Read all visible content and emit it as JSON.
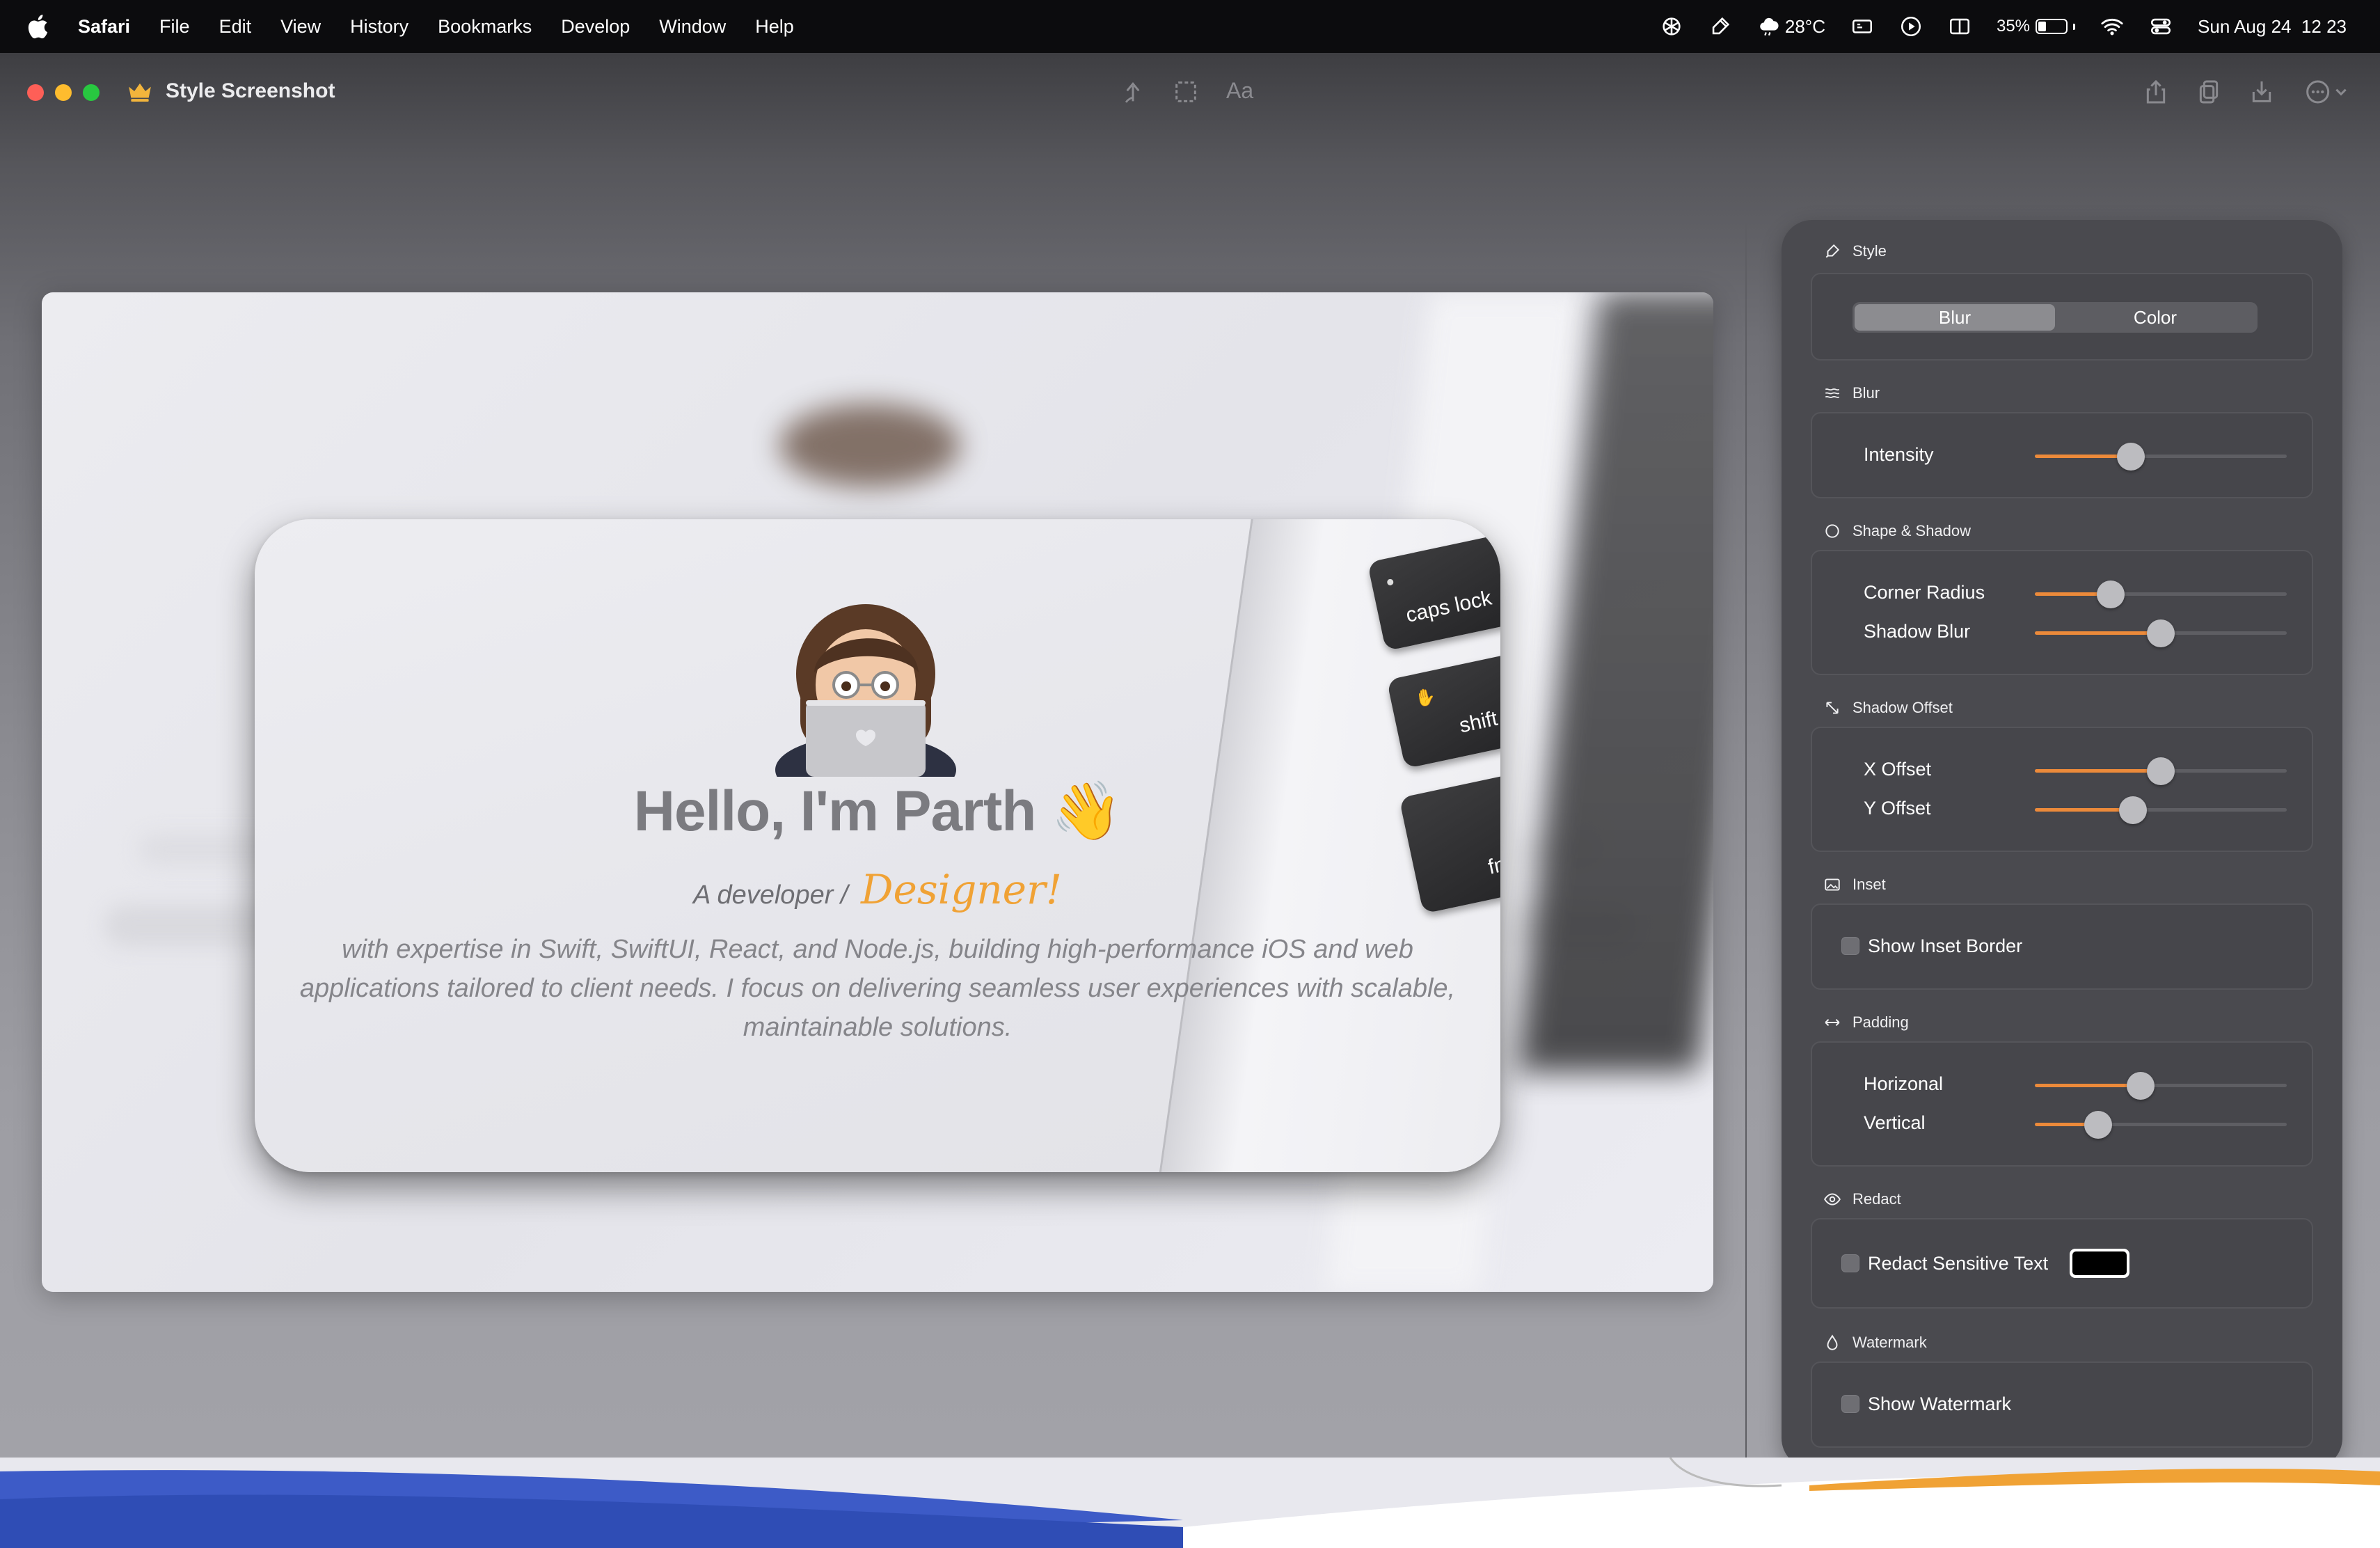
{
  "menubar": {
    "app_name": "Safari",
    "menus": [
      "File",
      "Edit",
      "View",
      "History",
      "Bookmarks",
      "Develop",
      "Window",
      "Help"
    ],
    "weather": "28°C",
    "battery_percent": "35%",
    "battery_level": 0.35,
    "datetime": "Sun Aug 24  12 23"
  },
  "window": {
    "title": "Style Screenshot",
    "toolbar_text_button": "Aa"
  },
  "preview": {
    "heading": "Hello, I'm Parth 👋",
    "sub_prefix": "A developer /",
    "sub_highlight": "Designer!",
    "bio": "with expertise in Swift, SwiftUI, React, and Node.js, building high-performance iOS and web applications tailored to client needs. I focus on delivering seamless user experiences with scalable, maintainable solutions.",
    "keys": [
      "caps lock",
      "shift",
      "fn"
    ]
  },
  "panel": {
    "style": {
      "title": "Style",
      "options": [
        "Blur",
        "Color"
      ],
      "selected": "Blur"
    },
    "blur": {
      "title": "Blur",
      "intensity_label": "Intensity",
      "intensity_value": 0.38
    },
    "shape": {
      "title": "Shape & Shadow",
      "corner_label": "Corner Radius",
      "corner_value": 0.3,
      "shadow_blur_label": "Shadow Blur",
      "shadow_blur_value": 0.5
    },
    "offset": {
      "title": "Shadow Offset",
      "x_label": "X Offset",
      "x_value": 0.5,
      "y_label": "Y Offset",
      "y_value": 0.39
    },
    "inset": {
      "title": "Inset",
      "checkbox_label": "Show Inset Border",
      "checked": false
    },
    "padding": {
      "title": "Padding",
      "h_label": "Horizonal",
      "h_value": 0.42,
      "v_label": "Vertical",
      "v_value": 0.25
    },
    "redact": {
      "title": "Redact",
      "checkbox_label": "Redact Sensitive Text",
      "checked": false,
      "color": "#000000"
    },
    "watermark": {
      "title": "Watermark",
      "checkbox_label": "Show Watermark",
      "checked": false
    }
  },
  "colors": {
    "accent": "#ec8a3a",
    "designer": "#f0a235",
    "panel_bg": "#4a4a4f"
  }
}
